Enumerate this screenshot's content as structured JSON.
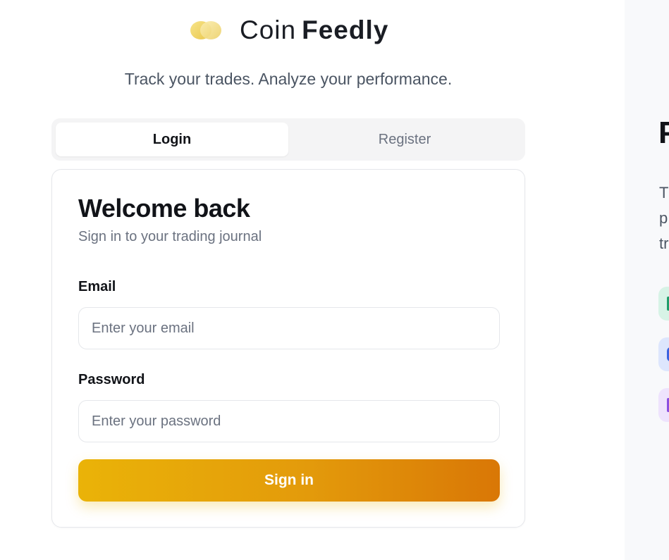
{
  "brand": {
    "logo_icon": "gold-coins-logo-icon",
    "name_light": "Coin",
    "name_bold": "Feedly",
    "tagline": "Track your trades. Analyze your performance."
  },
  "tabs": [
    {
      "label": "Login",
      "active": true
    },
    {
      "label": "Register",
      "active": false
    }
  ],
  "login_card": {
    "title": "Welcome back",
    "subtitle": "Sign in to your trading journal",
    "email": {
      "label": "Email",
      "value": "",
      "placeholder": "Enter your email"
    },
    "password": {
      "label": "Password",
      "value": "",
      "placeholder": "Enter your password"
    },
    "submit_label": "Sign in"
  },
  "side_panel": {
    "title_fragment": "P",
    "desc_fragment": "T\np\ntr",
    "feature_icons": [
      "feature-icon-green",
      "feature-icon-blue",
      "feature-icon-purple"
    ]
  },
  "colors": {
    "accent_start": "#eab308",
    "accent_end": "#d97706",
    "tab_bg": "#f4f4f5",
    "side_panel_bg": "#f8f9fb"
  }
}
